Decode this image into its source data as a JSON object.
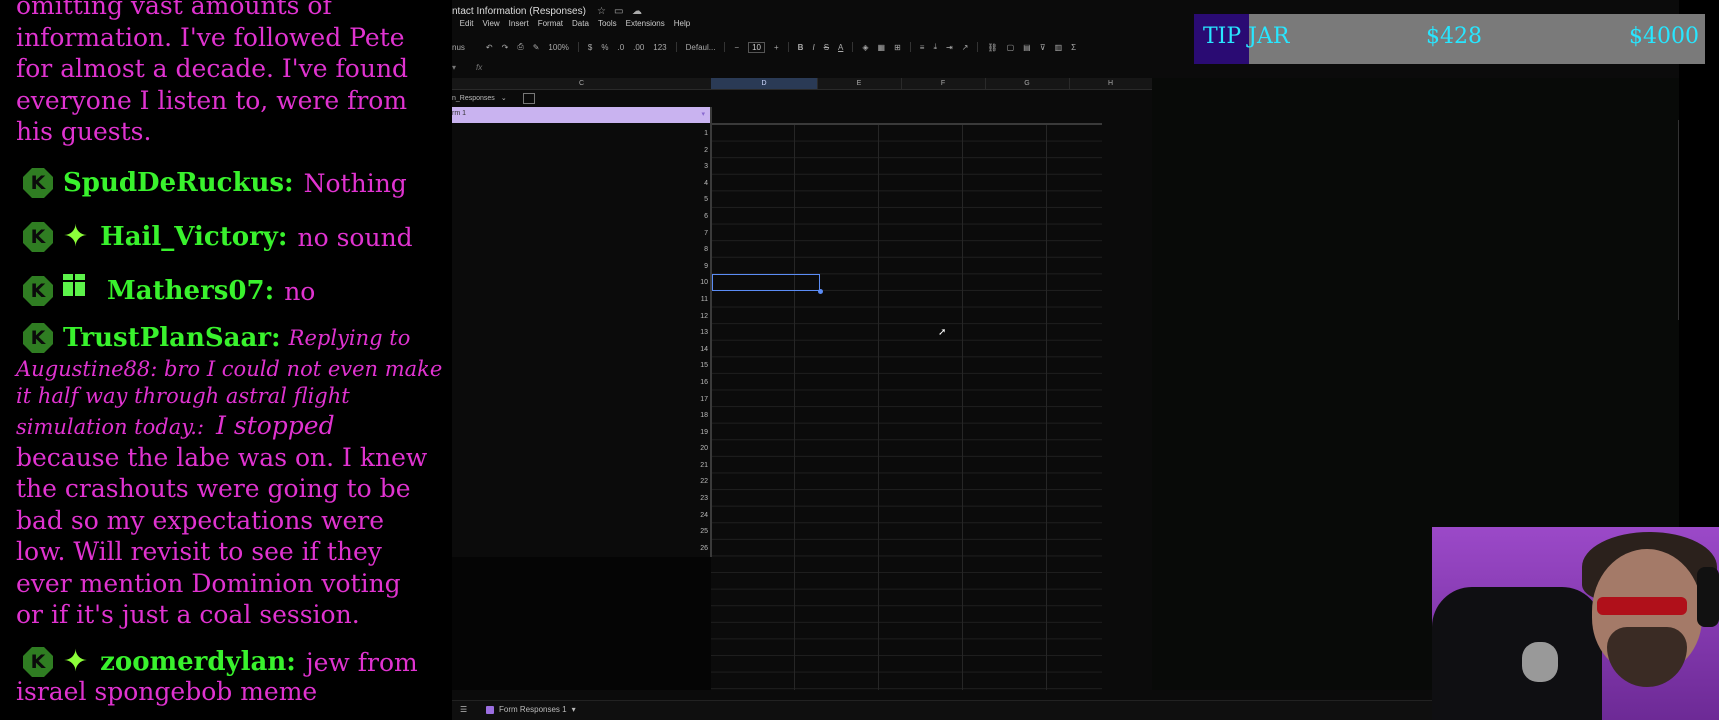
{
  "chat": {
    "top_text": [
      "omitting vast amounts of",
      "information. I've followed Pete",
      "for almost a decade. I've found",
      "everyone I listen to, were from",
      "his guests."
    ],
    "badge_letter": "K",
    "messages": [
      {
        "user": "SpudDeRuckus:",
        "text": "Nothing"
      },
      {
        "user": "Hail_Victory:",
        "text": "no sound"
      },
      {
        "user": "Mathers07:",
        "text": "no"
      },
      {
        "user": "TrustPlanSaar:",
        "reply": "Replying to",
        "reply_lines": [
          "Augustine88: bro I could not even make",
          "it half way through astral flight",
          "simulation today.:"
        ],
        "first_text": "I stopped",
        "text_lines": [
          "because the labe was on. I knew",
          "the crashouts were going to be",
          "bad so my expectations were",
          "low. Will revisit to see if they",
          "ever mention Dominion voting",
          "or if it's just a coal session."
        ]
      },
      {
        "user": "zoomerdylan:",
        "text": "jew from",
        "text_lines": [
          "israel spongebob meme"
        ]
      }
    ],
    "colors": {
      "username": "#39f22d",
      "message": "#e033d0",
      "badge": "#2f7d22"
    },
    "icons": [
      "sparkle-icon",
      "gift-icon"
    ]
  },
  "sheet": {
    "title": "ntact Information (Responses)",
    "menu": [
      "Edit",
      "View",
      "Insert",
      "Format",
      "Data",
      "Tools",
      "Extensions",
      "Help"
    ],
    "toolbar": {
      "menus": "nus",
      "zoom": "100%",
      "currency": "$",
      "percent": "%",
      "decimals_less": ".0",
      "decimals_more": ".00",
      "number_format": "123",
      "font": "Defaul...",
      "font_size": "10",
      "bold": "B",
      "italic": "I",
      "strike": "S",
      "text_color": "A",
      "sum": "Σ"
    },
    "fx": "fx",
    "columns": [
      "C",
      "D",
      "E",
      "F",
      "G",
      "H"
    ],
    "selected_column": "D",
    "table_tab": "n_Responses",
    "group_label": "rm 1",
    "row_numbers": [
      "1",
      "2",
      "3",
      "4",
      "5",
      "6",
      "7",
      "8",
      "9",
      "10",
      "11",
      "12",
      "13",
      "14",
      "15",
      "16",
      "17",
      "18",
      "19",
      "20",
      "21",
      "22",
      "23",
      "24",
      "25",
      "26"
    ],
    "selected_cell": "D10",
    "bottom_tab": "Form Responses 1",
    "accent": "#5b8cf5"
  },
  "tipjar": {
    "label": "TIP JAR",
    "amount": "$428",
    "goal": "$4000",
    "progress": 0.107,
    "text_color": "#28e6ff"
  }
}
